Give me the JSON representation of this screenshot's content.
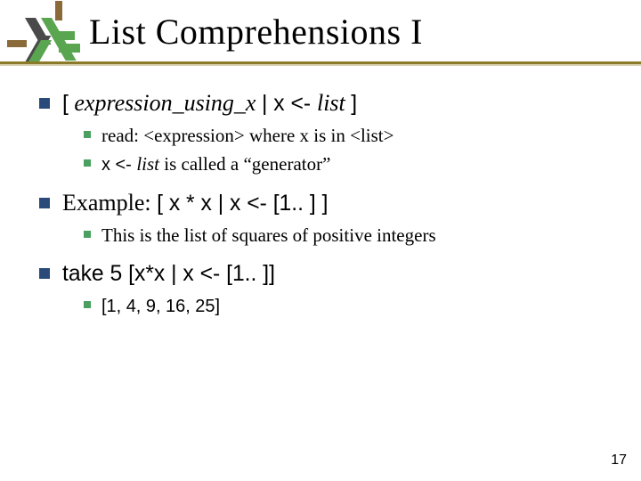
{
  "title": "List Comprehensions I",
  "bullets": {
    "b1": {
      "p1": "[",
      "p2": " expression_using_x ",
      "p3": "|",
      "p4": " x <- ",
      "p5": "list ",
      "p6": "]",
      "sub": {
        "s1": "read: <expression> where x is in <list>",
        "s2a": "x <- ",
        "s2b": "list",
        "s2c": "  is called a “generator”"
      }
    },
    "b2": {
      "p1": "Example: ",
      "p2": "[ x * x | x <- [1.. ] ]",
      "sub": {
        "s1": "This is the list of squares of positive integers"
      }
    },
    "b3": {
      "p1": "take 5 [x*x | x <- [1.. ]]",
      "sub": {
        "s1": "[1, 4, 9, 16, 25]"
      }
    }
  },
  "pagenum": "17"
}
